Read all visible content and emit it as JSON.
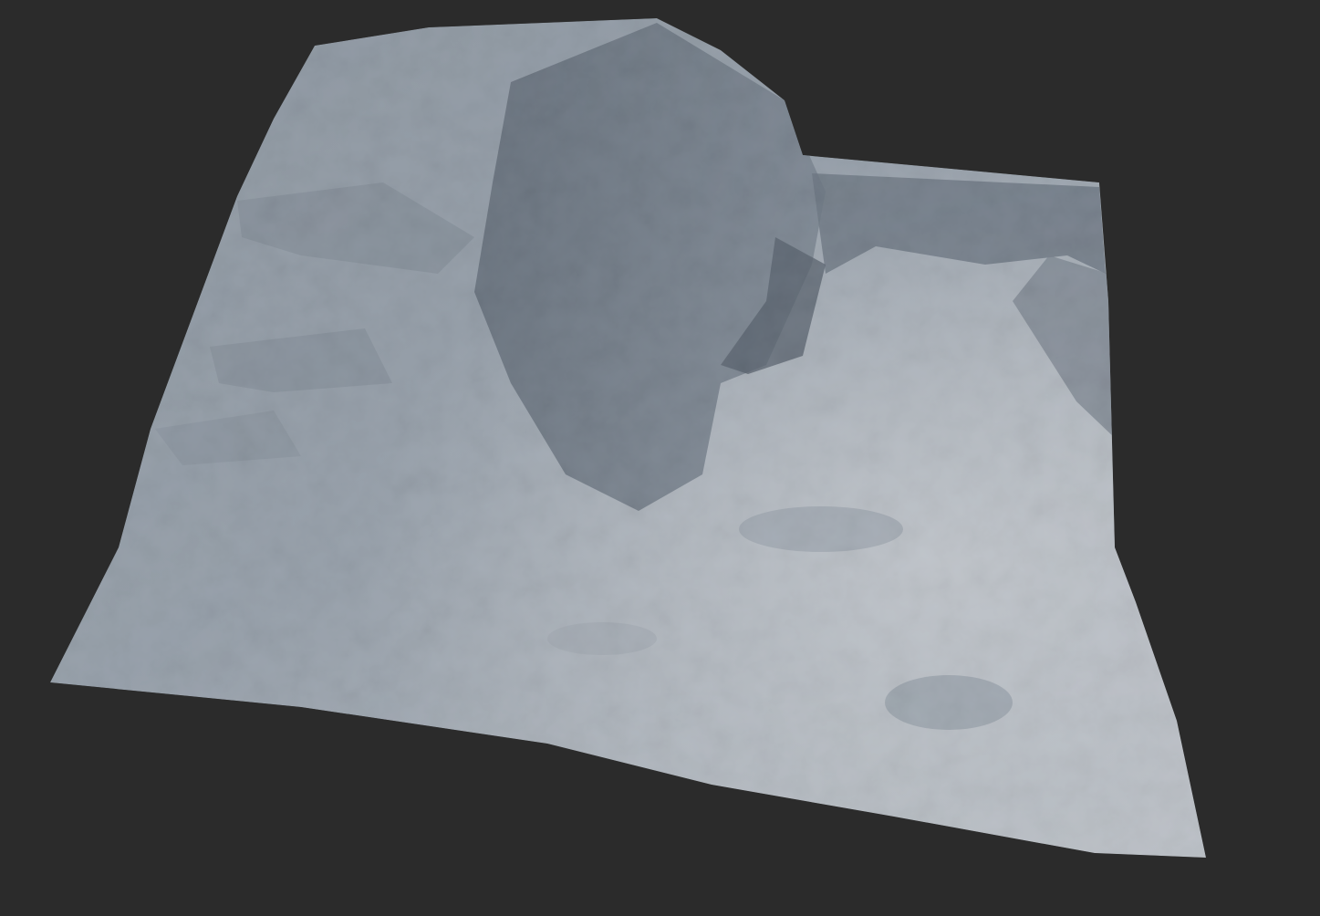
{
  "scene": {
    "background_color": "#2b2b2b",
    "terrain_colors": {
      "light": "#c9ccd0",
      "mid": "#9aa3ad",
      "dark": "#505a66",
      "shadow": "#3a4350"
    },
    "subject": "terrain-heightfield-render"
  }
}
